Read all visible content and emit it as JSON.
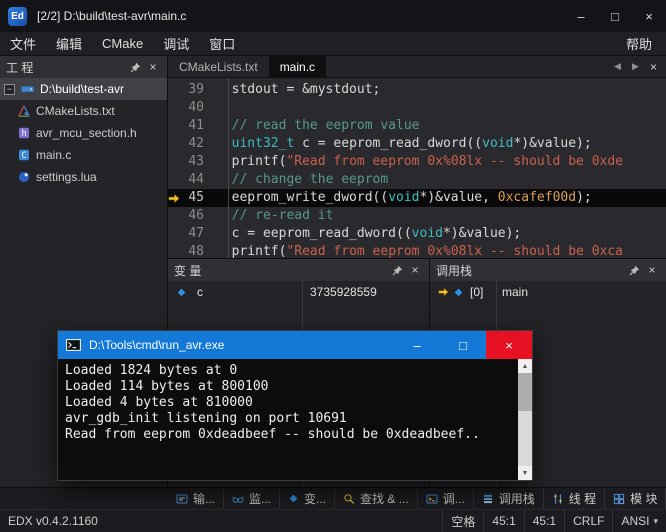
{
  "window": {
    "logo_text": "Ed",
    "title": "[2/2] D:\\build\\test-avr\\main.c"
  },
  "icons": {
    "minimize": "–",
    "maximize": "□",
    "close": "×",
    "tab_prev": "◀",
    "tab_next": "▶",
    "chevron_down": "▾",
    "scroll_up": "▲",
    "scroll_down": "▼",
    "expander": "−"
  },
  "menubar": {
    "items": [
      "文件",
      "编辑",
      "CMake",
      "调试",
      "窗口"
    ],
    "right_items": [
      "帮助"
    ]
  },
  "project": {
    "title": "工 程",
    "items": [
      {
        "label": "D:\\build\\test-avr",
        "icon": "drive",
        "root": true,
        "selected": true
      },
      {
        "label": "CMakeLists.txt",
        "icon": "cmake"
      },
      {
        "label": "avr_mcu_section.h",
        "icon": "header-file"
      },
      {
        "label": "main.c",
        "icon": "c-file"
      },
      {
        "label": "settings.lua",
        "icon": "lua-file"
      }
    ]
  },
  "editor": {
    "tabs": [
      {
        "label": "CMakeLists.txt",
        "active": false
      },
      {
        "label": "main.c",
        "active": true
      }
    ],
    "current_line": "45",
    "lines": [
      {
        "num": "39",
        "segs": [
          [
            "plain",
            "  stdout = &mystdout;"
          ]
        ]
      },
      {
        "num": "40",
        "segs": []
      },
      {
        "num": "41",
        "segs": [
          [
            "comment",
            "  // read the eeprom value"
          ]
        ]
      },
      {
        "num": "42",
        "segs": [
          [
            "plain",
            "  "
          ],
          [
            "type",
            "uint32_t"
          ],
          [
            "plain",
            " c = eeprom_read_dword(("
          ],
          [
            "type",
            "void"
          ],
          [
            "plain",
            "*)&value);"
          ]
        ]
      },
      {
        "num": "43",
        "segs": [
          [
            "plain",
            "  printf("
          ],
          [
            "string",
            "\"Read from eeprom 0x%08lx -- should be 0xde"
          ]
        ]
      },
      {
        "num": "44",
        "segs": [
          [
            "comment",
            "  // change the eeprom"
          ]
        ]
      },
      {
        "num": "45",
        "segs": [
          [
            "plain",
            "  eeprom_write_dword(("
          ],
          [
            "type",
            "void"
          ],
          [
            "plain",
            "*)&value, "
          ],
          [
            "number",
            "0xcafef00d"
          ],
          [
            "plain",
            ");"
          ]
        ]
      },
      {
        "num": "46",
        "segs": [
          [
            "comment",
            "  // re-read it"
          ]
        ]
      },
      {
        "num": "47",
        "segs": [
          [
            "plain",
            "  c = eeprom_read_dword(("
          ],
          [
            "type",
            "void"
          ],
          [
            "plain",
            "*)&value);"
          ]
        ]
      },
      {
        "num": "48",
        "segs": [
          [
            "plain",
            "  printf("
          ],
          [
            "string",
            "\"Read from eeprom 0x%08lx -- should be 0xca"
          ]
        ]
      }
    ]
  },
  "panels": {
    "variables": {
      "title": "变 量",
      "rows": [
        {
          "name": "c",
          "value": "3735928559"
        }
      ]
    },
    "callstack": {
      "title": "调用栈",
      "rows": [
        {
          "frame": "[0]",
          "function": "main"
        }
      ]
    }
  },
  "console": {
    "title": "D:\\Tools\\cmd\\run_avr.exe",
    "lines": [
      "Loaded 1824 bytes at 0",
      "Loaded 114 bytes at 800100",
      "Loaded 4 bytes at 810000",
      "avr_gdb_init listening on port 10691",
      "Read from eeprom 0xdeadbeef -- should be 0xdeadbeef.."
    ]
  },
  "toolbar": {
    "buttons": [
      {
        "id": "output",
        "label": "输..."
      },
      {
        "id": "watch",
        "label": "监..."
      },
      {
        "id": "variables",
        "label": "变..."
      },
      {
        "id": "find",
        "label": "查找 & ..."
      },
      {
        "id": "debug",
        "label": "调..."
      },
      {
        "id": "callstack",
        "label": "调用栈"
      },
      {
        "id": "threads",
        "label": "线 程"
      },
      {
        "id": "modules",
        "label": "模 块"
      }
    ]
  },
  "statusbar": {
    "left": "EDX v0.4.2.1160",
    "right": [
      "空格",
      "45:1",
      "45:1",
      "CRLF",
      "ANSI"
    ]
  },
  "colors": {
    "console_titlebar_blue": "#1478d6",
    "close_button_red": "#e81123",
    "current_line_arrow_yellow": "#f2c230",
    "selected_row_gray": "#3f4146"
  }
}
